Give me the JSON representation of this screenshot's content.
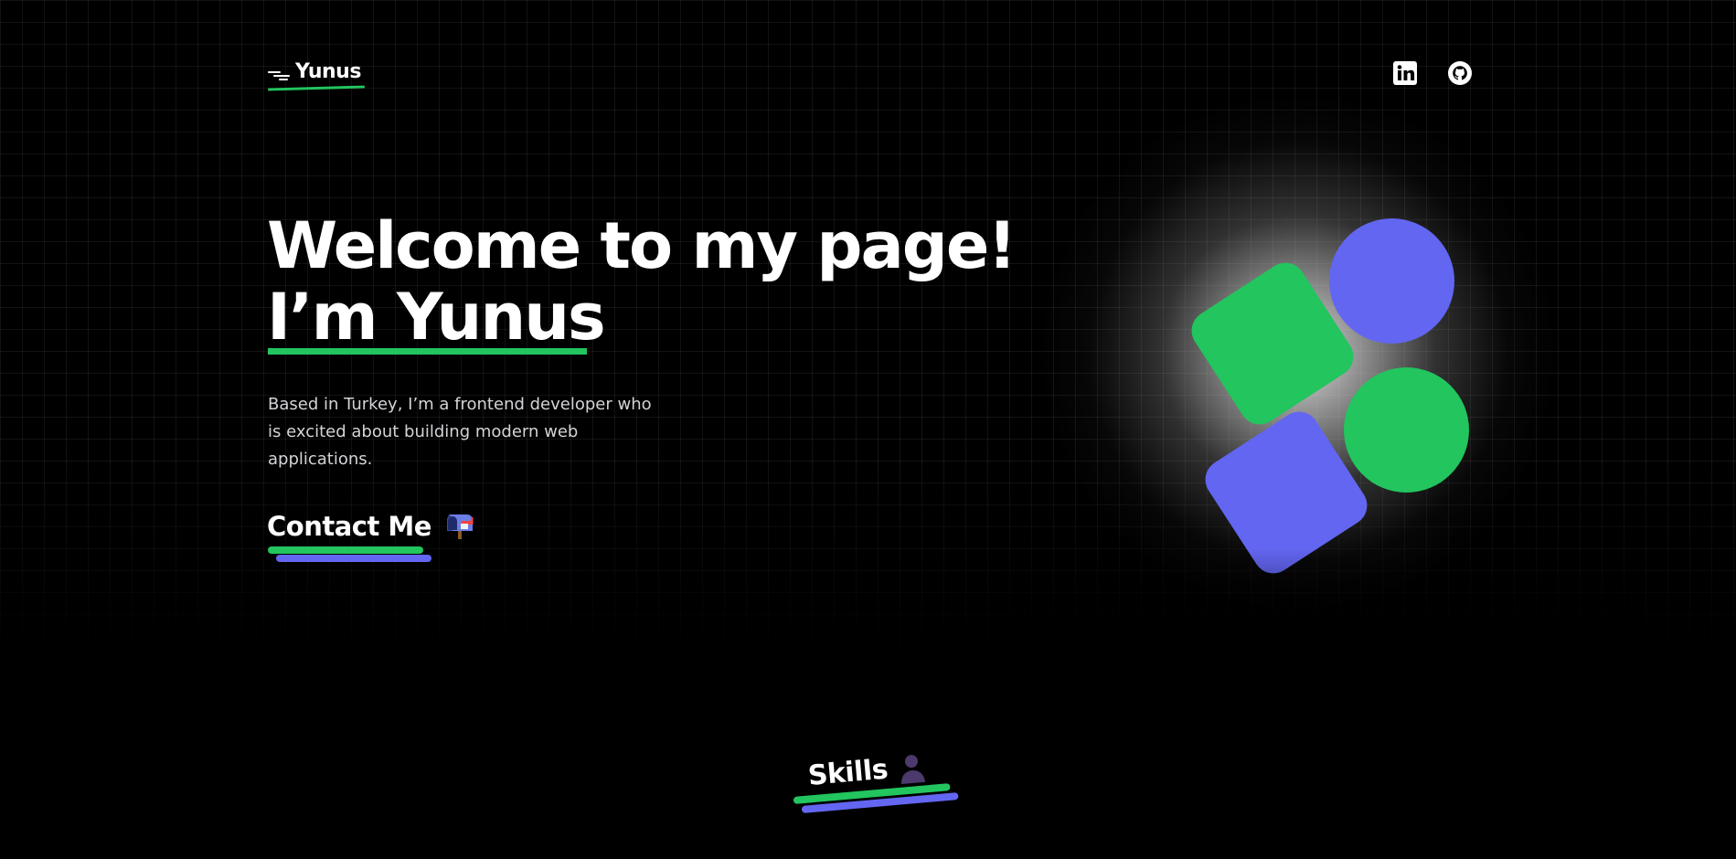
{
  "header": {
    "logo_text": "Yunus",
    "social_links": [
      {
        "icon": "linkedin-icon"
      },
      {
        "icon": "github-icon"
      }
    ]
  },
  "hero": {
    "title_line1": "Welcome to my page!",
    "title_line2": "I’m Yunus",
    "description": "Based in Turkey, I’m a frontend developer who is excited about building modern web applications.",
    "contact_label": "Contact Me",
    "contact_icon": "mailbox-icon"
  },
  "skills": {
    "label": "Skills",
    "icon": "person-silhouette-icon"
  },
  "colors": {
    "background": "#000000",
    "accent_green": "#22c55e",
    "accent_blue": "#6366f1",
    "text": "#ffffff",
    "muted_text": "#d4d4d8"
  }
}
